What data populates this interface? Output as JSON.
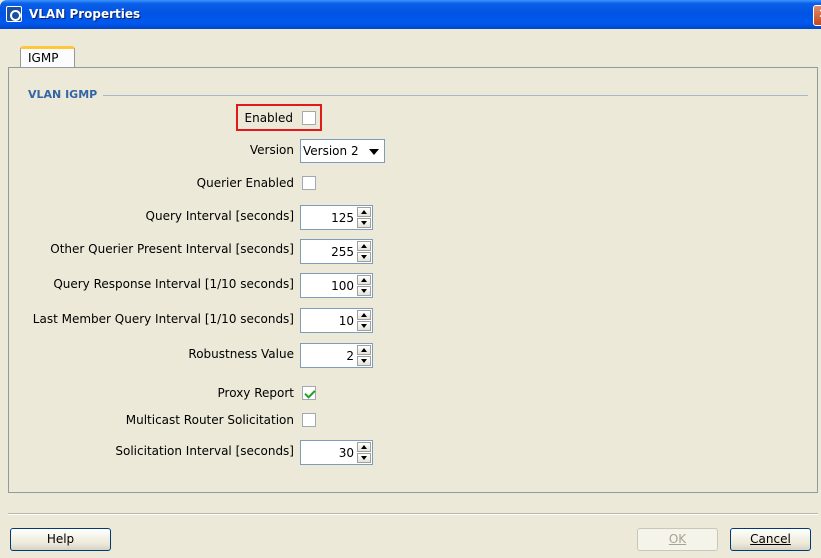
{
  "window": {
    "title": "VLAN Properties",
    "close_glyph": "✕"
  },
  "tabs": [
    {
      "label": "IGMP",
      "selected": true
    }
  ],
  "group": {
    "title": "VLAN IGMP"
  },
  "fields": {
    "enabled": {
      "label": "Enabled",
      "checked": false
    },
    "version": {
      "label": "Version",
      "value": "Version 2"
    },
    "querier_enabled": {
      "label": "Querier Enabled",
      "checked": false
    },
    "query_interval": {
      "label": "Query Interval [seconds]",
      "value": "125"
    },
    "other_querier": {
      "label": "Other Querier Present Interval [seconds]",
      "value": "255"
    },
    "query_response": {
      "label": "Query Response Interval [1/10 seconds]",
      "value": "100"
    },
    "last_member": {
      "label": "Last Member Query Interval [1/10 seconds]",
      "value": "10"
    },
    "robustness": {
      "label": "Robustness Value",
      "value": "2"
    },
    "proxy_report": {
      "label": "Proxy Report",
      "checked": true
    },
    "mcast_router": {
      "label": "Multicast Router Solicitation",
      "checked": false
    },
    "solicitation": {
      "label": "Solicitation Interval [seconds]",
      "value": "30"
    }
  },
  "buttons": {
    "help": "Help",
    "ok": "OK",
    "cancel": "Cancel"
  },
  "colors": {
    "highlight": "#e01a1a",
    "titlebar": "#0054e3",
    "group_title": "#3465a4"
  }
}
